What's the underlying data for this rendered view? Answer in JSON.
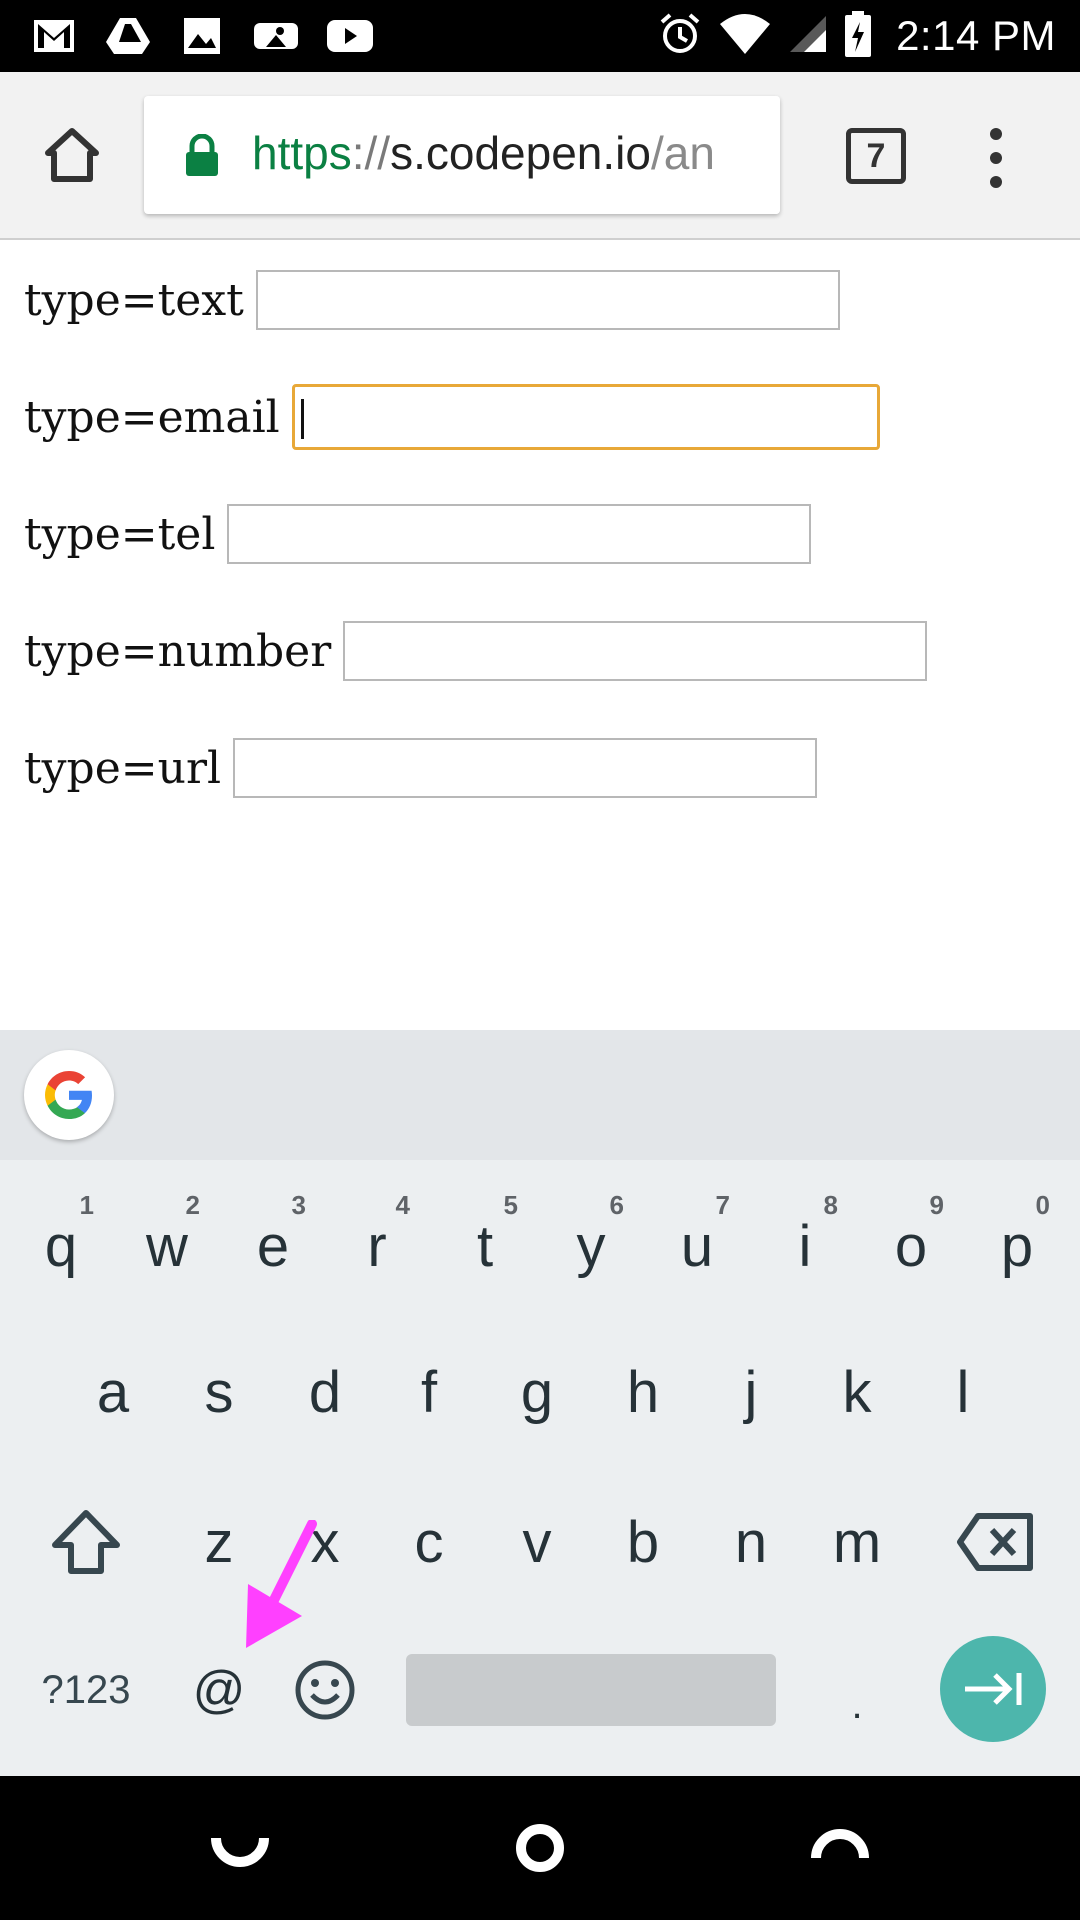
{
  "status_bar": {
    "time": "2:14 PM",
    "left_icons": [
      "gmail-icon",
      "drive-icon",
      "photos-icon",
      "mlb-icon",
      "youtube-icon"
    ],
    "right_icons": [
      "alarm-icon",
      "wifi-icon",
      "signal-icon",
      "battery-charging-icon"
    ]
  },
  "browser": {
    "url_scheme": "https",
    "url_sep": "://",
    "url_host": "s.codepen.io",
    "url_path": "/an",
    "tab_count": "7",
    "secure_color": "#0b8043"
  },
  "form": {
    "rows": [
      {
        "label": "type=text",
        "value": ""
      },
      {
        "label": "type=email",
        "value": ""
      },
      {
        "label": "type=tel",
        "value": ""
      },
      {
        "label": "type=number",
        "value": ""
      },
      {
        "label": "type=url",
        "value": ""
      }
    ],
    "focused_index": 1,
    "focus_color": "#e8a838"
  },
  "keyboard": {
    "row1": [
      {
        "ch": "q",
        "hint": "1"
      },
      {
        "ch": "w",
        "hint": "2"
      },
      {
        "ch": "e",
        "hint": "3"
      },
      {
        "ch": "r",
        "hint": "4"
      },
      {
        "ch": "t",
        "hint": "5"
      },
      {
        "ch": "y",
        "hint": "6"
      },
      {
        "ch": "u",
        "hint": "7"
      },
      {
        "ch": "i",
        "hint": "8"
      },
      {
        "ch": "o",
        "hint": "9"
      },
      {
        "ch": "p",
        "hint": "0"
      }
    ],
    "row2": [
      "a",
      "s",
      "d",
      "f",
      "g",
      "h",
      "j",
      "k",
      "l"
    ],
    "row3": [
      "z",
      "x",
      "c",
      "v",
      "b",
      "n",
      "m"
    ],
    "symbols_label": "?123",
    "at_label": "@",
    "period_label": ".",
    "enter_color": "#4db6ac"
  },
  "annotation": {
    "arrow_color": "#ff40ff"
  }
}
